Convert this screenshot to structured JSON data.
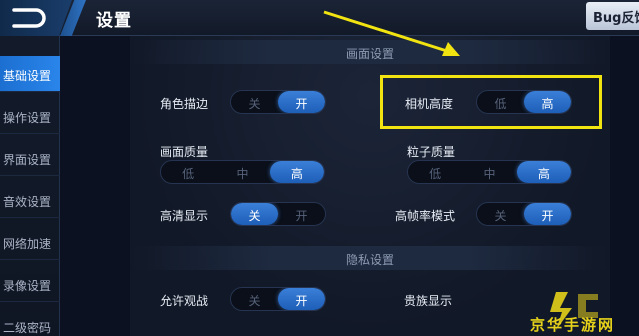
{
  "header": {
    "title": "设置",
    "bug_label": "Bug反馈"
  },
  "sidebar": {
    "items": [
      {
        "label": "基础设置",
        "active": true
      },
      {
        "label": "操作设置",
        "active": false
      },
      {
        "label": "界面设置",
        "active": false
      },
      {
        "label": "音效设置",
        "active": false
      },
      {
        "label": "网络加速",
        "active": false
      },
      {
        "label": "录像设置",
        "active": false
      },
      {
        "label": "二级密码",
        "active": false
      }
    ]
  },
  "sections": {
    "display": "画面设置",
    "privacy": "隐私设置"
  },
  "settings": {
    "outline": {
      "label": "角色描边",
      "options": [
        "关",
        "开"
      ],
      "selected": "开"
    },
    "camera_height": {
      "label": "相机高度",
      "options": [
        "低",
        "高"
      ],
      "selected": "高"
    },
    "quality": {
      "label": "画面质量",
      "options": [
        "低",
        "中",
        "高"
      ],
      "selected": "高"
    },
    "particle_quality": {
      "label": "粒子质量",
      "options": [
        "低",
        "中",
        "高"
      ],
      "selected": "高"
    },
    "hd_display": {
      "label": "高清显示",
      "options": [
        "关",
        "开"
      ],
      "selected": "关"
    },
    "high_fps": {
      "label": "高帧率模式",
      "options": [
        "关",
        "开"
      ],
      "selected": "开"
    },
    "allow_spectate": {
      "label": "允许观战",
      "options": [
        "关",
        "开"
      ],
      "selected": "开"
    },
    "noble_display": {
      "label": "贵族显示"
    }
  },
  "watermark": {
    "text": "京华手游网"
  },
  "colors": {
    "accent": "#2a85ea",
    "highlight": "#f2e411"
  }
}
